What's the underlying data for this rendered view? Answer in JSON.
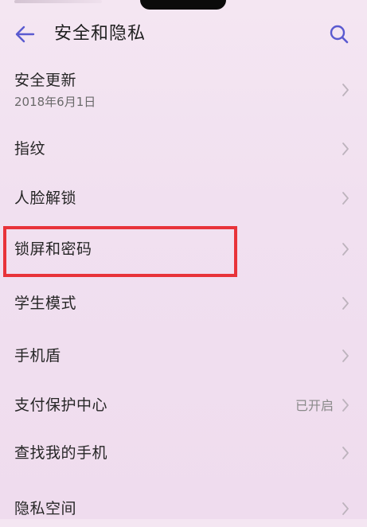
{
  "header": {
    "title": "安全和隐私"
  },
  "list": {
    "items": [
      {
        "label": "安全更新",
        "sub": "2018年6月1日",
        "value": ""
      },
      {
        "label": "指纹",
        "sub": "",
        "value": ""
      },
      {
        "label": "人脸解锁",
        "sub": "",
        "value": ""
      },
      {
        "label": "锁屏和密码",
        "sub": "",
        "value": ""
      },
      {
        "label": "学生模式",
        "sub": "",
        "value": ""
      },
      {
        "label": "手机盾",
        "sub": "",
        "value": ""
      },
      {
        "label": "支付保护中心",
        "sub": "",
        "value": "已开启"
      },
      {
        "label": "查找我的手机",
        "sub": "",
        "value": ""
      },
      {
        "label": "隐私空间",
        "sub": "",
        "value": ""
      }
    ]
  },
  "colors": {
    "accent": "#5a5ad0",
    "highlight": "#e8333a",
    "background": "#f2e2f0"
  },
  "icons": {
    "back": "arrow-left-icon",
    "search": "search-icon",
    "chevron": "chevron-right-icon"
  }
}
